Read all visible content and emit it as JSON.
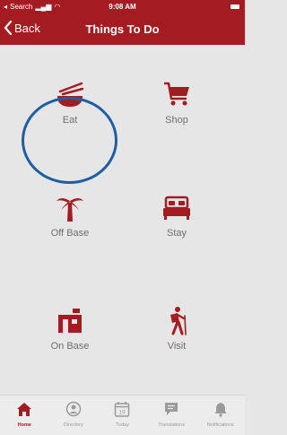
{
  "status_bar": {
    "carrier": "Search",
    "time": "9:08 AM"
  },
  "nav": {
    "back_label": "Back",
    "title": "Things To Do"
  },
  "tiles": [
    {
      "label": "Eat",
      "icon": "bowl-chopsticks-icon"
    },
    {
      "label": "Shop",
      "icon": "shopping-cart-icon"
    },
    {
      "label": "Off Base",
      "icon": "palm-tree-icon"
    },
    {
      "label": "Stay",
      "icon": "bed-icon"
    },
    {
      "label": "On Base",
      "icon": "mailbox-building-icon"
    },
    {
      "label": "Visit",
      "icon": "hiker-icon"
    }
  ],
  "tabs": [
    {
      "label": "Home",
      "icon": "home-icon",
      "active": true
    },
    {
      "label": "Directory",
      "icon": "person-icon",
      "active": false
    },
    {
      "label": "Today",
      "icon": "calendar-icon",
      "day": "19",
      "active": false
    },
    {
      "label": "Translations",
      "icon": "chat-icon",
      "active": false
    },
    {
      "label": "Notifications",
      "icon": "bell-icon",
      "active": false
    }
  ],
  "colors": {
    "brand": "#a41c22",
    "background": "#e6e6e6",
    "highlight": "#1e5fa3",
    "label": "#707070"
  }
}
